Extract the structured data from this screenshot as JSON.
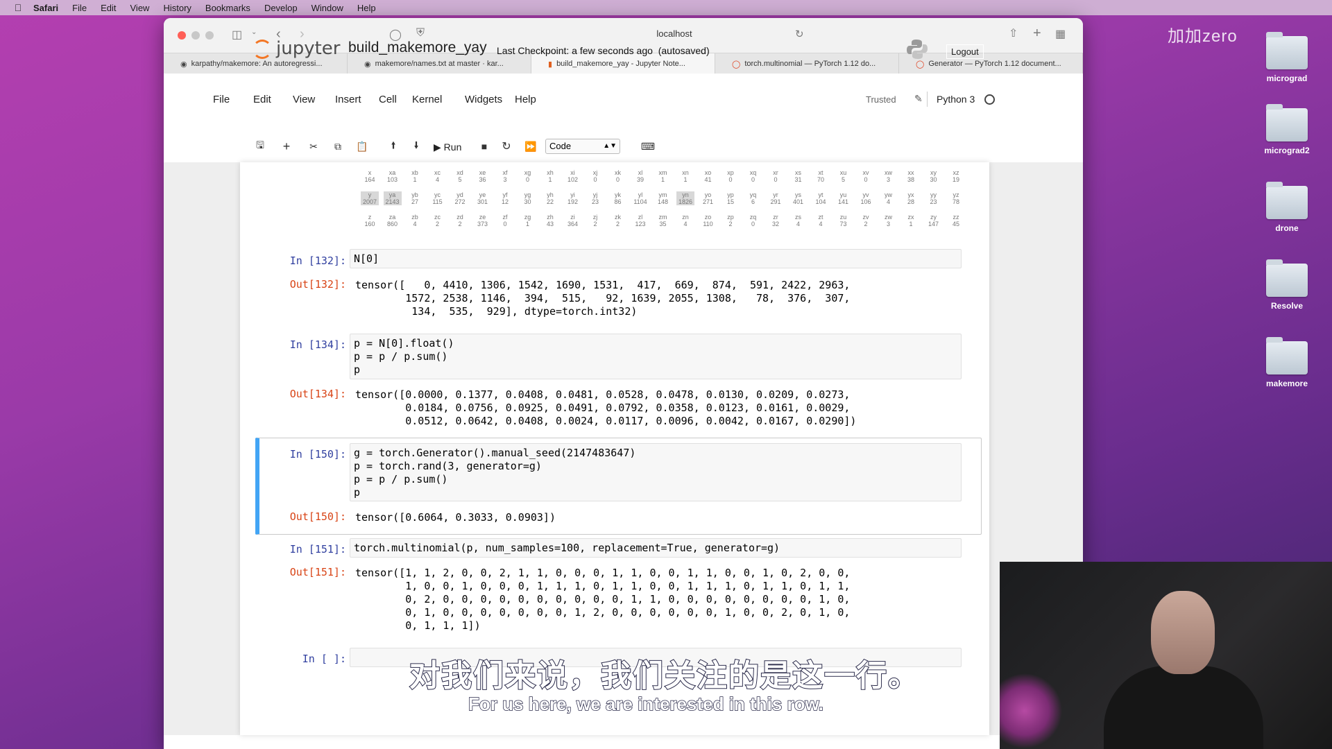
{
  "menubar": {
    "app": "Safari",
    "items": [
      "File",
      "Edit",
      "View",
      "History",
      "Bookmarks",
      "Develop",
      "Window",
      "Help"
    ]
  },
  "watermark": "加加zero",
  "desktop_icons": [
    "micrograd",
    "micrograd2",
    "drone",
    "Resolve",
    "makemore"
  ],
  "browser": {
    "url": "localhost",
    "tabs": [
      "karpathy/makemore: An autoregressi...",
      "makemore/names.txt at master · kar...",
      "build_makemore_yay - Jupyter Note...",
      "torch.multinomial — PyTorch 1.12 do...",
      "Generator — PyTorch 1.12 document..."
    ]
  },
  "jupyter": {
    "logo": "jupyter",
    "notebook_name": "build_makemore_yay",
    "checkpoint": "Last Checkpoint: a few seconds ago",
    "autosaved": "(autosaved)",
    "logout": "Logout",
    "menu": [
      "File",
      "Edit",
      "View",
      "Insert",
      "Cell",
      "Kernel",
      "Widgets",
      "Help"
    ],
    "trusted": "Trusted",
    "kernel": "Python 3",
    "run_label": "Run",
    "cell_type": "Code"
  },
  "bigram_grid": {
    "row1": [
      [
        "x",
        "164"
      ],
      [
        "xa",
        "103"
      ],
      [
        "xb",
        "1"
      ],
      [
        "xc",
        "4"
      ],
      [
        "xd",
        "5"
      ],
      [
        "xe",
        "36"
      ],
      [
        "xf",
        "3"
      ],
      [
        "xg",
        "0"
      ],
      [
        "xh",
        "1"
      ],
      [
        "xi",
        "102"
      ],
      [
        "xj",
        "0"
      ],
      [
        "xk",
        "0"
      ],
      [
        "xl",
        "39"
      ],
      [
        "xm",
        "1"
      ],
      [
        "xn",
        "1"
      ],
      [
        "xo",
        "41"
      ],
      [
        "xp",
        "0"
      ],
      [
        "xq",
        "0"
      ],
      [
        "xr",
        "0"
      ],
      [
        "xs",
        "31"
      ],
      [
        "xt",
        "70"
      ],
      [
        "xu",
        "5"
      ],
      [
        "xv",
        "0"
      ],
      [
        "xw",
        "3"
      ],
      [
        "xx",
        "38"
      ],
      [
        "xy",
        "30"
      ],
      [
        "xz",
        "19"
      ]
    ],
    "row2": [
      [
        "y",
        "2007"
      ],
      [
        "ya",
        "2143"
      ],
      [
        "yb",
        "27"
      ],
      [
        "yc",
        "115"
      ],
      [
        "yd",
        "272"
      ],
      [
        "ye",
        "301"
      ],
      [
        "yf",
        "12"
      ],
      [
        "yg",
        "30"
      ],
      [
        "yh",
        "22"
      ],
      [
        "yi",
        "192"
      ],
      [
        "yj",
        "23"
      ],
      [
        "yk",
        "86"
      ],
      [
        "yl",
        "1104"
      ],
      [
        "ym",
        "148"
      ],
      [
        "yn",
        "1826"
      ],
      [
        "yo",
        "271"
      ],
      [
        "yp",
        "15"
      ],
      [
        "yq",
        "6"
      ],
      [
        "yr",
        "291"
      ],
      [
        "ys",
        "401"
      ],
      [
        "yt",
        "104"
      ],
      [
        "yu",
        "141"
      ],
      [
        "yv",
        "106"
      ],
      [
        "yw",
        "4"
      ],
      [
        "yx",
        "28"
      ],
      [
        "yy",
        "23"
      ],
      [
        "yz",
        "78"
      ]
    ],
    "row3": [
      [
        "z",
        "160"
      ],
      [
        "za",
        "860"
      ],
      [
        "zb",
        "4"
      ],
      [
        "zc",
        "2"
      ],
      [
        "zd",
        "2"
      ],
      [
        "ze",
        "373"
      ],
      [
        "zf",
        "0"
      ],
      [
        "zg",
        "1"
      ],
      [
        "zh",
        "43"
      ],
      [
        "zi",
        "364"
      ],
      [
        "zj",
        "2"
      ],
      [
        "zk",
        "2"
      ],
      [
        "zl",
        "123"
      ],
      [
        "zm",
        "35"
      ],
      [
        "zn",
        "4"
      ],
      [
        "zo",
        "110"
      ],
      [
        "zp",
        "2"
      ],
      [
        "zq",
        "0"
      ],
      [
        "zr",
        "32"
      ],
      [
        "zs",
        "4"
      ],
      [
        "zt",
        "4"
      ],
      [
        "zu",
        "73"
      ],
      [
        "zv",
        "2"
      ],
      [
        "zw",
        "3"
      ],
      [
        "zx",
        "1"
      ],
      [
        "zy",
        "147"
      ],
      [
        "zz",
        "45"
      ]
    ]
  },
  "cells": {
    "c132": {
      "in_prompt": "In [132]:",
      "code": "N[0]",
      "out_prompt": "Out[132]:",
      "output": "tensor([   0, 4410, 1306, 1542, 1690, 1531,  417,  669,  874,  591, 2422, 2963,\n        1572, 2538, 1146,  394,  515,   92, 1639, 2055, 1308,   78,  376,  307,\n         134,  535,  929], dtype=torch.int32)"
    },
    "c134": {
      "in_prompt": "In [134]:",
      "code": "p = N[0].float()\np = p / p.sum()\np",
      "out_prompt": "Out[134]:",
      "output": "tensor([0.0000, 0.1377, 0.0408, 0.0481, 0.0528, 0.0478, 0.0130, 0.0209, 0.0273,\n        0.0184, 0.0756, 0.0925, 0.0491, 0.0792, 0.0358, 0.0123, 0.0161, 0.0029,\n        0.0512, 0.0642, 0.0408, 0.0024, 0.0117, 0.0096, 0.0042, 0.0167, 0.0290])"
    },
    "c150": {
      "in_prompt": "In [150]:",
      "code": "g = torch.Generator().manual_seed(2147483647)\np = torch.rand(3, generator=g)\np = p / p.sum()\np",
      "out_prompt": "Out[150]:",
      "output": "tensor([0.6064, 0.3033, 0.0903])"
    },
    "c151": {
      "in_prompt": "In [151]:",
      "code": "torch.multinomial(p, num_samples=100, replacement=True, generator=g)",
      "out_prompt": "Out[151]:",
      "output": "tensor([1, 1, 2, 0, 0, 2, 1, 1, 0, 0, 0, 1, 1, 0, 0, 1, 1, 0, 0, 1, 0, 2, 0, 0,\n        1, 0, 0, 1, 0, 0, 0, 1, 1, 1, 0, 1, 1, 0, 0, 1, 1, 1, 0, 1, 1, 0, 1, 1,\n        0, 2, 0, 0, 0, 0, 0, 0, 0, 0, 0, 0, 1, 1, 0, 0, 0, 0, 0, 0, 0, 0, 1, 0,\n        0, 1, 0, 0, 0, 0, 0, 0, 0, 1, 2, 0, 0, 0, 0, 0, 0, 1, 0, 0, 2, 0, 1, 0,\n        0, 1, 1, 1])"
    },
    "empty": {
      "in_prompt": "In [ ]:"
    }
  },
  "subtitles": {
    "zh": "对我们来说，我们关注的是这一行。",
    "en": "For us here, we are interested in this row."
  },
  "colors": {
    "in_prompt": "#303f9f",
    "out_prompt": "#d84315",
    "selected_border": "#42a5f5",
    "jupyter_orange": "#f37726"
  }
}
